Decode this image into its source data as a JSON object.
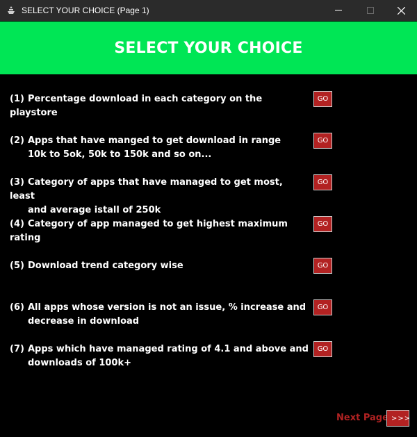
{
  "window": {
    "title": "SELECT YOUR CHOICE (Page 1)"
  },
  "header": {
    "title": "SELECT YOUR CHOICE"
  },
  "options": [
    {
      "number": "(1)",
      "line1": "Percentage download in each category on the playstore",
      "line2": "",
      "button_label": "GO"
    },
    {
      "number": "(2)",
      "line1": "Apps that have manged to get download in range",
      "line2": "10k to 5ok, 50k to 150k and so on...",
      "button_label": "GO"
    },
    {
      "number": "(3)",
      "line1": "Category of apps that have managed to get most, least",
      "line2": "and average istall of 250k",
      "button_label": "GO"
    },
    {
      "number": "(4)",
      "line1": "Category of app managed to get highest maximum rating",
      "line2": "",
      "button_label": "GO"
    },
    {
      "number": "(5)",
      "line1": "Download trend category wise",
      "line2": "",
      "button_label": "GO"
    },
    {
      "number": "(6)",
      "line1": "All apps whose version is not an issue, % increase and",
      "line2": "decrease in download",
      "button_label": "GO"
    },
    {
      "number": "(7)",
      "line1": "Apps which have managed rating of 4.1 and above and",
      "line2": "downloads of 100k+",
      "button_label": "GO"
    }
  ],
  "footer": {
    "next_label": "Next Page",
    "next_button": ">>>"
  },
  "colors": {
    "header_bg": "#00e655",
    "body_bg": "#000000",
    "button_bg": "#b22222",
    "titlebar_bg": "#2b2b2b"
  },
  "icons": {
    "app": "app-icon",
    "minimize": "minimize-icon",
    "maximize": "maximize-icon",
    "close": "close-icon"
  }
}
